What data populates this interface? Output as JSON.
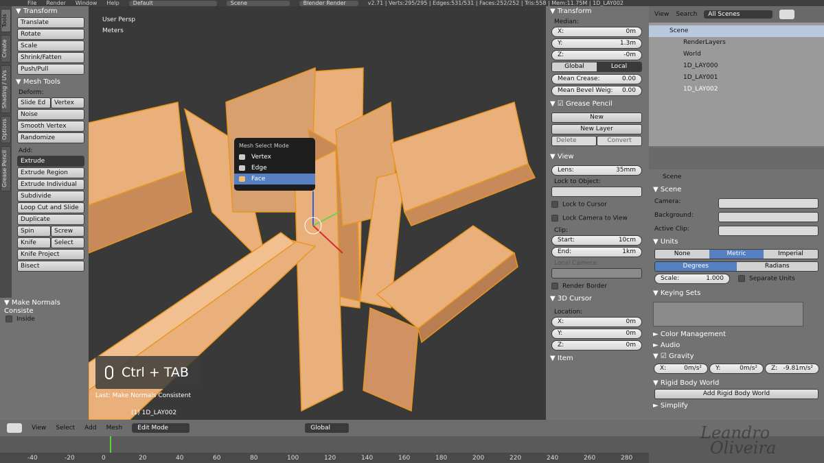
{
  "topbar": {
    "menus": [
      "File",
      "Render",
      "Window",
      "Help"
    ],
    "layout": "Default",
    "scene": "Scene",
    "engine": "Blender Render",
    "stats": "v2.71 | Verts:295/295 | Edges:531/531 | Faces:252/252 | Tris:558 | Mem:11.75M | 1D_LAY002"
  },
  "vtabs": [
    "Tools",
    "Create",
    "Shading / UVs",
    "Options",
    "Grease Pencil"
  ],
  "tools": {
    "transform": {
      "title": "Transform",
      "items": [
        "Translate",
        "Rotate",
        "Scale",
        "Shrink/Fatten",
        "Push/Pull"
      ]
    },
    "mesh_tools": {
      "title": "Mesh Tools",
      "deform_label": "Deform:",
      "deform": [
        "Slide Ed",
        "Vertex",
        "Noise",
        "Smooth Vertex",
        "Randomize"
      ],
      "add_label": "Add:",
      "extrude": "Extrude",
      "add": [
        "Extrude Region",
        "Extrude Individual",
        "Subdivide",
        "Loop Cut and Slide",
        "Duplicate"
      ],
      "spin": "Spin",
      "screw": "Screw",
      "knife": "Knife",
      "select": "Select",
      "knife_project": "Knife Project",
      "bisect": "Bisect"
    }
  },
  "operator_panel": {
    "title": "Make Normals Consiste",
    "inside": "Inside"
  },
  "viewport": {
    "persp": "User Persp",
    "units": "Meters",
    "menu_title": "Mesh Select Mode",
    "menu_items": [
      "Vertex",
      "Edge",
      "Face"
    ],
    "shortcut": "Ctrl + TAB",
    "last_op": "Last: Make Normals Consistent",
    "object": "(1) 1D_LAY002"
  },
  "npanel": {
    "transform": "Transform",
    "median": "Median:",
    "x": "0m",
    "y": "1.3m",
    "z": "-0m",
    "global": "Global",
    "local": "Local",
    "mean_crease": "0.00",
    "mean_bevel": "0.00",
    "mean_crease_label": "Mean Crease:",
    "mean_bevel_label": "Mean Bevel Weig:",
    "grease": "Grease Pencil",
    "new": "New",
    "new_layer": "New Layer",
    "delete_frame": "Delete Fra...",
    "convert": "Convert",
    "view": "View",
    "lens_label": "Lens:",
    "lens": "35mm",
    "lock_obj": "Lock to Object:",
    "lock_cursor": "Lock to Cursor",
    "lock_camera": "Lock Camera to View",
    "clip": "Clip:",
    "start_label": "Start:",
    "start": "10cm",
    "end_label": "End:",
    "end": "1km",
    "local_camera": "Local Camera:",
    "render_border": "Render Border",
    "cursor": "3D Cursor",
    "location": "Location:",
    "cx": "0m",
    "cy": "0m",
    "cz": "0m",
    "item": "Item"
  },
  "outliner": {
    "view": "View",
    "search": "Search",
    "filter": "All Scenes",
    "rows": [
      "Scene",
      "RenderLayers",
      "World",
      "1D_LAY000",
      "1D_LAY001",
      "1D_LAY002"
    ]
  },
  "props": {
    "crumb": "Scene",
    "scene_panel": "Scene",
    "camera": "Camera:",
    "background": "Background:",
    "active_clip": "Active Clip:",
    "units": "Units",
    "none": "None",
    "metric": "Metric",
    "imperial": "Imperial",
    "degrees": "Degrees",
    "radians": "Radians",
    "scale_label": "Scale:",
    "scale": "1.000",
    "separate": "Separate Units",
    "keying": "Keying Sets",
    "color_mgmt": "Color Management",
    "audio": "Audio",
    "gravity": "Gravity",
    "gx": "0m/s²",
    "gy": "0m/s²",
    "gz": "-9.81m/s²",
    "rigid": "Rigid Body World",
    "add_rigid": "Add Rigid Body World",
    "simplify": "Simplify"
  },
  "bottombar": {
    "items": [
      "View",
      "Select",
      "Add",
      "Mesh"
    ],
    "mode": "Edit Mode",
    "orient": "Global"
  },
  "ruler": [
    "-40",
    "-20",
    "0",
    "20",
    "40",
    "60",
    "80",
    "100",
    "120",
    "140",
    "160",
    "180",
    "200",
    "220",
    "240",
    "260",
    "280"
  ],
  "watermark": [
    "Leandro",
    "Oliveira"
  ]
}
